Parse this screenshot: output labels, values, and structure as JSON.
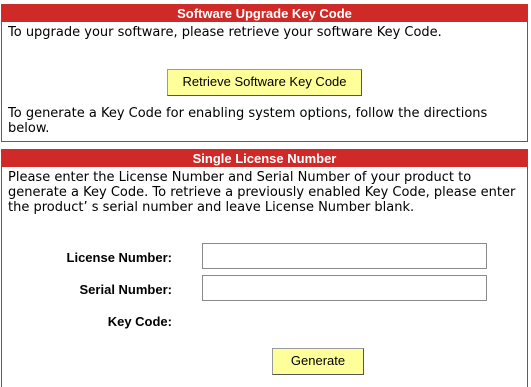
{
  "upgrade_panel": {
    "title": "Software Upgrade Key Code",
    "intro": "To upgrade your software, please retrieve your software Key Code.",
    "retrieve_button": "Retrieve Software Key Code",
    "note": "To generate a Key Code for enabling system options, follow the directions below."
  },
  "license_panel": {
    "title": "Single License Number",
    "instructions": "Please enter the License Number and Serial Number of your product to generate a Key Code. To retrieve a previously enabled Key Code, please enter the product’ s serial number and leave License Number blank.",
    "license_label": "License Number:",
    "license_value": "",
    "serial_label": "Serial Number:",
    "serial_value": "",
    "keycode_label": "Key Code:",
    "generate_button": "Generate"
  },
  "colors": {
    "header_bg": "#cf2a27",
    "button_bg": "#ffff99"
  }
}
